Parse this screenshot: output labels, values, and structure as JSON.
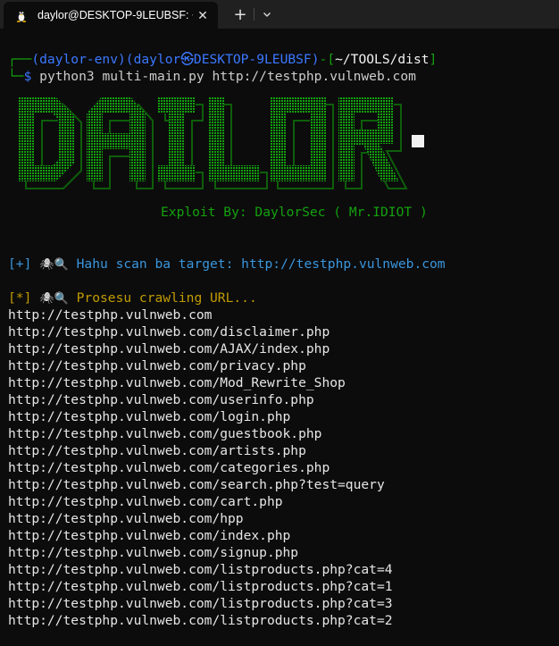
{
  "window": {
    "tab_title": "daylor@DESKTOP-9LEUBSF: ~",
    "tab_icon": "linux-tux-icon",
    "close_glyph": "✕",
    "new_tab_glyph": "+",
    "dropdown_glyph": "⌄"
  },
  "prompt": {
    "corner_top": "┌──",
    "env": "(daylor-env)",
    "user": "(daylor",
    "at_symbol": "㉿",
    "host": "DESKTOP-9LEUBSF",
    "close_paren": ")",
    "dash": "-",
    "path_open": "[",
    "path": "~/TOOLS/dist",
    "path_close": "]",
    "corner_bottom": "└─",
    "dollar": "$",
    "command": " python3 multi-main.py http://testphp.vulnweb.com"
  },
  "banner": {
    "logo_text": "DAILOR",
    "credit": "Exploit By: DaylorSec ( Mr.IDIOT )"
  },
  "scan": {
    "marker": "[+]",
    "icons": "🕷🔍",
    "text": " Hahu scan ba target: http://testphp.vulnweb.com"
  },
  "crawl": {
    "marker": "[*]",
    "icons": "🕷🔍",
    "text": " Prosesu crawling URL..."
  },
  "urls": [
    "http://testphp.vulnweb.com",
    "http://testphp.vulnweb.com/disclaimer.php",
    "http://testphp.vulnweb.com/AJAX/index.php",
    "http://testphp.vulnweb.com/privacy.php",
    "http://testphp.vulnweb.com/Mod_Rewrite_Shop",
    "http://testphp.vulnweb.com/userinfo.php",
    "http://testphp.vulnweb.com/login.php",
    "http://testphp.vulnweb.com/guestbook.php",
    "http://testphp.vulnweb.com/artists.php",
    "http://testphp.vulnweb.com/categories.php",
    "http://testphp.vulnweb.com/search.php?test=query",
    "http://testphp.vulnweb.com/cart.php",
    "http://testphp.vulnweb.com/hpp",
    "http://testphp.vulnweb.com/index.php",
    "http://testphp.vulnweb.com/signup.php",
    "http://testphp.vulnweb.com/listproducts.php?cat=4",
    "http://testphp.vulnweb.com/listproducts.php?cat=1",
    "http://testphp.vulnweb.com/listproducts.php?cat=3",
    "http://testphp.vulnweb.com/listproducts.php?cat=2"
  ],
  "colors": {
    "background": "#0c0c0c",
    "green": "#13a10e",
    "blue": "#3b78ff",
    "cyan": "#3a96dd",
    "yellow": "#c19c00"
  }
}
